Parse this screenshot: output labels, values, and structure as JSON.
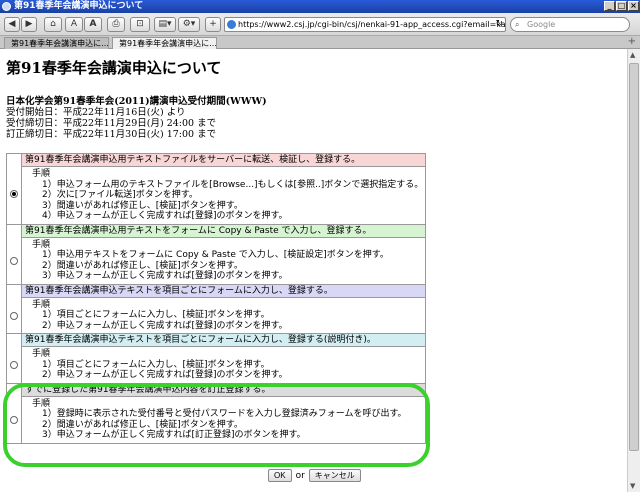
{
  "window": {
    "title": "第91春季年会講演申込について"
  },
  "toolbar": {
    "url": "https://www2.csj.jp/cgi-bin/csj/nenkai-91-app_access.cgi?email=kai",
    "search_placeholder": "Google"
  },
  "tabs": [
    {
      "label": "第91春季年会講演申込に..."
    },
    {
      "label": "第91春季年会講演申込に..."
    }
  ],
  "page": {
    "title": "第91春季年会講演申込について",
    "period_heading": "日本化学会第91春季年会(2011)講演申込受付期間(WWW)",
    "period_lines": [
      "受付開始日：平成22年11月16日(火) より",
      "受付締切日：平成22年11月29日(月) 24:00 まで",
      "訂正締切日：平成22年11月30日(火) 17:00 まで"
    ],
    "options": [
      {
        "header": "第91春季年会講演申込用テキストファイルをサーバーに転送、検証し、登録する。",
        "procedure_label": "手順",
        "steps": [
          "1）申込フォーム用のテキストファイルを[Browse...]もしくは[参照..]ボタンで選択指定する。",
          "2）次に[ファイル転送]ボタンを押す。",
          "3）間違いがあれば修正し、[検証]ボタンを押す。",
          "4）申込フォームが正しく完成すれば[登録]のボタンを押す。"
        ]
      },
      {
        "header": "第91春季年会講演申込用テキストをフォームに Copy & Paste で入力し、登録する。",
        "procedure_label": "手順",
        "steps": [
          "1）申込用テキストをフォームに Copy & Paste で入力し、[検証設定]ボタンを押す。",
          "2）間違いがあれば修正し、[検証]ボタンを押す。",
          "3）申込フォームが正しく完成すれば[登録]のボタンを押す。"
        ]
      },
      {
        "header": "第91春季年会講演申込テキストを項目ごとにフォームに入力し、登録する。",
        "procedure_label": "手順",
        "steps": [
          "1）項目ごとにフォームに入力し、[検証]ボタンを押す。",
          "2）申込フォームが正しく完成すれば[登録]のボタンを押す。"
        ]
      },
      {
        "header": "第91春季年会講演申込テキストを項目ごとにフォームに入力し、登録する(説明付き)。",
        "procedure_label": "手順",
        "steps": [
          "1）項目ごとにフォームに入力し、[検証]ボタンを押す。",
          "2）申込フォームが正しく完成すれば[登録]のボタンを押す。"
        ]
      },
      {
        "header": "すでに登録した第91春季年会講演申込内容を訂正登録する。",
        "procedure_label": "手順",
        "steps": [
          "1）登録時に表示された受付番号と受付パスワードを入力し登録済みフォームを呼び出す。",
          "2）間違いがあれば修正し、[検証]ボタンを押す。",
          "3）申込フォームが正しく完成すれば[訂正登録]のボタンを押す。"
        ]
      }
    ],
    "ok_label": "OK",
    "or_label": "or",
    "cancel_label": "キャンセル"
  },
  "colors": {
    "highlight": "#3bd12d",
    "titlebar": "#2a5bd7"
  }
}
